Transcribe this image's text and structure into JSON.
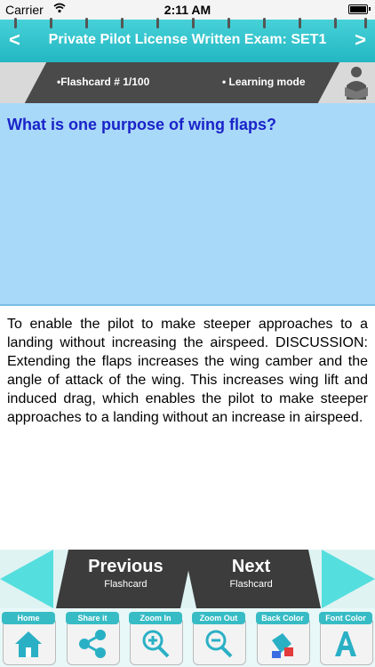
{
  "status": {
    "carrier": "Carrier",
    "time": "2:11 AM"
  },
  "nav": {
    "title": "Private Pilot License Written Exam: SET1",
    "back": "<",
    "forward": ">"
  },
  "info": {
    "flashcard": "•Flashcard #  1/100",
    "mode": "• Learning mode"
  },
  "question": {
    "text": "What is one purpose of wing flaps?"
  },
  "answer": {
    "text": "To enable the pilot to make steeper approaches to a landing without increasing the airspeed. DISCUSSION: Extending the flaps increases the wing camber and the angle of attack of the wing. This increases wing lift and induced drag, which enables the pilot to make steeper approaches to a landing without an increase in airspeed."
  },
  "buttons": {
    "previous": {
      "big": "Previous",
      "small": "Flashcard"
    },
    "next": {
      "big": "Next",
      "small": "Flashcard"
    }
  },
  "toolbar": [
    {
      "label": "Home",
      "icon": "home-icon"
    },
    {
      "label": "Share it",
      "icon": "share-icon"
    },
    {
      "label": "Zoom In",
      "icon": "zoom-in-icon"
    },
    {
      "label": "Zoom Out",
      "icon": "zoom-out-icon"
    },
    {
      "label": "Back Color",
      "icon": "paint-bucket-icon"
    },
    {
      "label": "Font Color",
      "icon": "font-color-icon"
    }
  ],
  "colors": {
    "accent": "#22b7c2",
    "question_bg": "#a9d9f8",
    "question_text": "#1a23c9",
    "dark_band": "#4a4a4a"
  }
}
